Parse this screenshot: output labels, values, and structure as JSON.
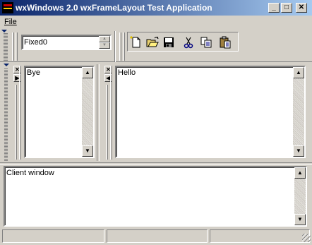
{
  "window": {
    "title": "wxWindows 2.0 wxFrameLayout Test Application"
  },
  "menu": {
    "items": [
      {
        "label": "File",
        "underline": "F"
      }
    ]
  },
  "toolbar": {
    "combo_value": "Fixed0",
    "buttons": [
      {
        "name": "new-file-icon"
      },
      {
        "name": "open-folder-icon"
      },
      {
        "name": "save-icon"
      },
      {
        "name": "cut-icon"
      },
      {
        "name": "copy-icon"
      },
      {
        "name": "paste-icon"
      }
    ]
  },
  "panes": {
    "left": {
      "text": "Bye"
    },
    "right": {
      "text": "Hello"
    }
  },
  "client": {
    "text": "Client window"
  },
  "statusbar": {
    "fields": [
      "",
      "",
      ""
    ]
  },
  "colors": {
    "titlebar_start": "#0a246a",
    "titlebar_end": "#a6caf0",
    "face": "#d4d0c8"
  }
}
